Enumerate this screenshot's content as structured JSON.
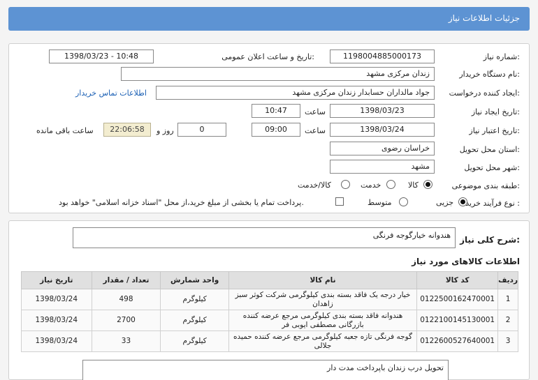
{
  "header": {
    "title": "جزئیات اطلاعات نیاز"
  },
  "form": {
    "need_number_label": "شماره نیاز:",
    "need_number": "1198004885000173",
    "announce_label": "تاریخ و ساعت اعلان عمومی:",
    "announce_value": "1398/03/23 - 10:48",
    "buyer_org_label": "نام دستگاه خریدار:",
    "buyer_org": "زندان مرکزی مشهد",
    "creator_label": "ایجاد کننده درخواست:",
    "creator": "جواد مالداران حسابدار زندان مرکزی مشهد",
    "contact_link": "اطلاعات تماس خریدار",
    "created_date_label": "تاریخ ایجاد نیاز:",
    "created_date": "1398/03/23",
    "created_time_label": "ساعت",
    "created_time": "10:47",
    "validity_label": "تاریخ اعتبار نیاز:",
    "validity_date": "1398/03/24",
    "validity_time_label": "ساعت",
    "validity_time": "09:00",
    "days": "0",
    "days_label": "روز و",
    "remaining_time": "22:06:58",
    "remaining_label": "ساعت باقی مانده",
    "province_label": "استان محل تحویل:",
    "province": "خراسان رضوی",
    "city_label": "شهر محل تحویل:",
    "city": "مشهد",
    "category_label": "طبقه بندی موضوعی:",
    "category_options": [
      "کالا",
      "خدمت",
      "کالا/خدمت"
    ],
    "process_label": "نوع فرآیند خرید :",
    "process_options": [
      "جزیی",
      "متوسط"
    ],
    "treasury_note": "پرداخت تمام یا بخشی از مبلغ خرید،از محل \"اسناد خزانه اسلامی\" خواهد بود."
  },
  "summary": {
    "label": "شرح کلی نیاز:",
    "text": "هندوانه خیارگوجه فرنگی"
  },
  "items_section": {
    "title": "اطلاعات کالاهای مورد نیاز",
    "columns": [
      "ردیف",
      "کد کالا",
      "نام کالا",
      "واحد شمارش",
      "تعداد / مقدار",
      "تاریخ نیاز"
    ],
    "rows": [
      {
        "row": "1",
        "code": "0122500162470001",
        "name": "خیار درجه یک فاقد بسته بندی کیلوگرمی شرکت کوثر سبز زاهدان",
        "unit": "کیلوگرم",
        "qty": "498",
        "date": "1398/03/24"
      },
      {
        "row": "2",
        "code": "0122100145130001",
        "name": "هندوانه فاقد بسته بندی کیلوگرمی مرجع عرضه کننده بازرگانی مصطفی ایوبی فر",
        "unit": "کیلوگرم",
        "qty": "2700",
        "date": "1398/03/24"
      },
      {
        "row": "3",
        "code": "0122600527640001",
        "name": "گوجه فرنگی تازه جعبه کیلوگرمی مرجع عرضه کننده حمیده جلالی",
        "unit": "کیلوگرم",
        "qty": "33",
        "date": "1398/03/24"
      }
    ]
  },
  "note": {
    "text": "تحویل درب زندان باپرداخت مدت دار"
  }
}
